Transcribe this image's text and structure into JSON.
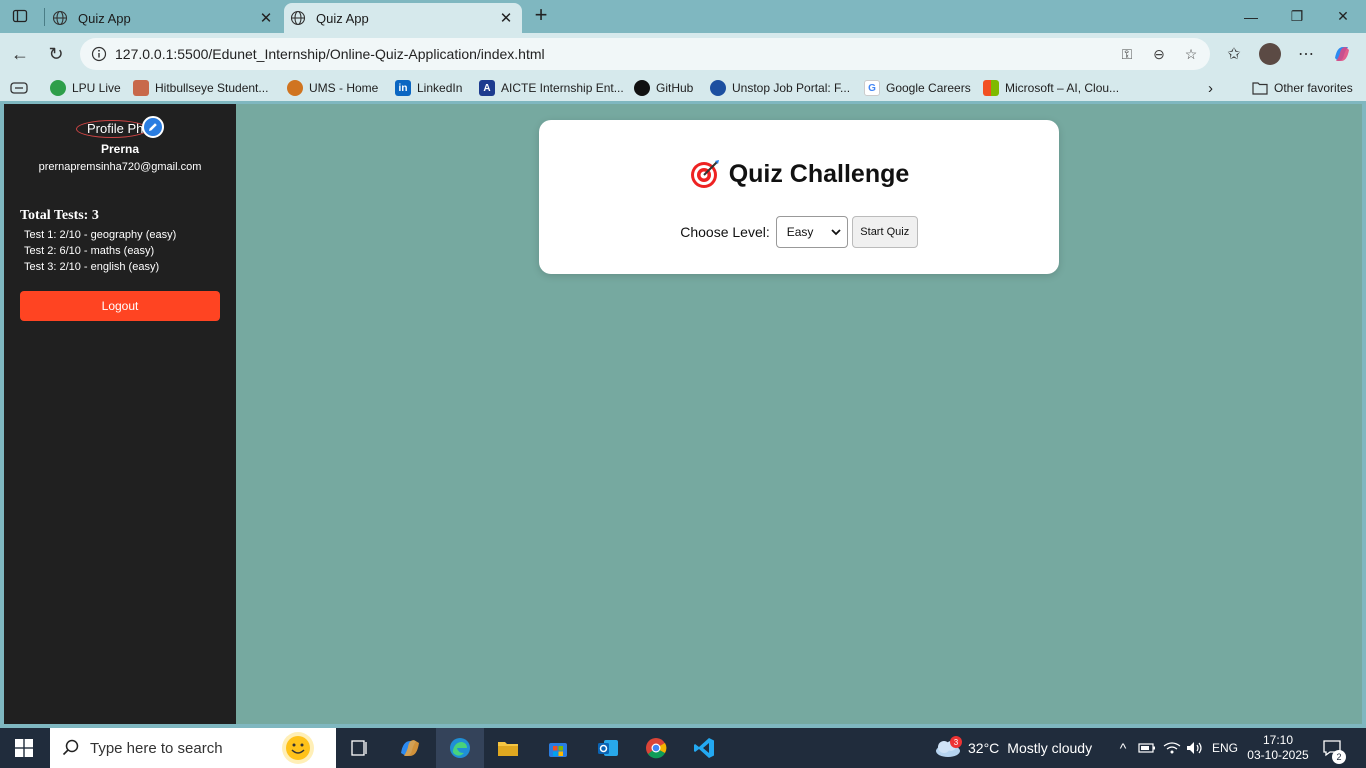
{
  "browser": {
    "tabs": [
      {
        "title": "Quiz App",
        "active": false
      },
      {
        "title": "Quiz App",
        "active": true
      }
    ],
    "url": "127.0.0.1:5500/Edunet_Internship/Online-Quiz-Application/index.html",
    "bookmarks": [
      {
        "label": "LPU Live",
        "icon": "lpu-live-icon",
        "color": "#2e9e4a"
      },
      {
        "label": "Hitbullseye Student...",
        "icon": "hitbullseye-icon",
        "color": "#c8694b"
      },
      {
        "label": "UMS - Home",
        "icon": "ums-icon",
        "color": "#d07420"
      },
      {
        "label": "LinkedIn",
        "icon": "linkedin-icon",
        "color": "#0a66c2"
      },
      {
        "label": "AICTE Internship Ent...",
        "icon": "aicte-icon",
        "color": "#1d3b8f"
      },
      {
        "label": "GitHub",
        "icon": "github-icon",
        "color": "#111111"
      },
      {
        "label": "Unstop Job Portal: F...",
        "icon": "unstop-icon",
        "color": "#1c4fa0"
      },
      {
        "label": "Google Careers",
        "icon": "google-icon",
        "color": "#4285f4"
      },
      {
        "label": "Microsoft – AI, Clou...",
        "icon": "microsoft-icon",
        "color": "#f25022"
      }
    ],
    "other_favorites": "Other favorites"
  },
  "sidebar": {
    "profile_alt": "Profile Photo",
    "name": "Prerna",
    "email": "prernapremsinha720@gmail.com",
    "total_tests": "Total Tests: 3",
    "tests": [
      "Test 1: 2/10 - geography (easy)",
      "Test 2: 6/10 - maths (easy)",
      "Test 3: 2/10 - english (easy)"
    ],
    "logout_label": "Logout"
  },
  "quiz": {
    "title": "Quiz Challenge",
    "level_label": "Choose Level:",
    "level_value": "Easy",
    "start_label": "Start Quiz"
  },
  "taskbar": {
    "search_placeholder": "Type here to search",
    "weather_temp": "32°C",
    "weather_desc": "Mostly cloudy",
    "weather_badge": "3",
    "lang": "ENG",
    "time": "17:10",
    "date": "03-10-2025",
    "notifications": "2"
  },
  "colors": {
    "sidebar_bg": "#202020",
    "page_bg": "#76a9a0",
    "logout_bg": "#ff4422",
    "edit_badge": "#2a7de1"
  }
}
